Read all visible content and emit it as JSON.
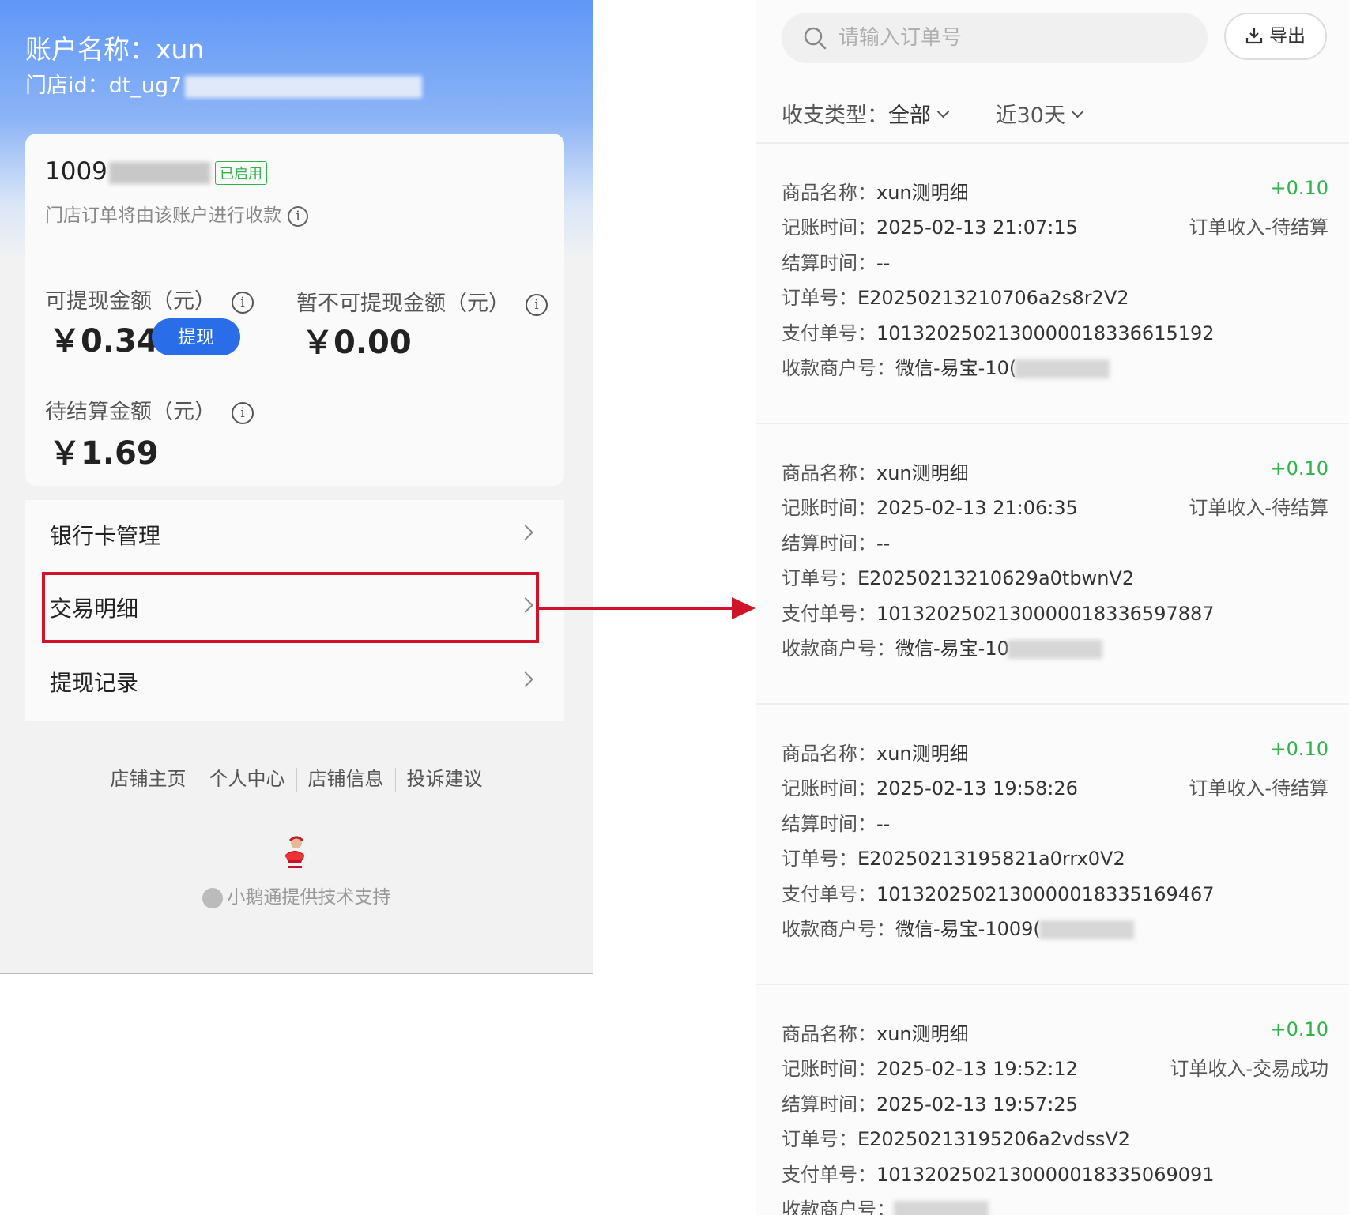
{
  "left": {
    "account_name": "账户名称：xun",
    "store_id": "门店id：dt_ug7",
    "card": {
      "number_prefix": "1009",
      "badge": "已启用",
      "note": "门店订单将由该账户进行收款",
      "withdrawable_label": "可提现金额（元）",
      "withdrawable_value": "￥0.34",
      "withdraw_button": "提现",
      "nonwithdrawable_label": "暂不可提现金额（元）",
      "nonwithdrawable_value": "￥0.00",
      "pending_label": "待结算金额（元）",
      "pending_value": "￥1.69"
    },
    "menu": [
      {
        "label": "银行卡管理"
      },
      {
        "label": "交易明细"
      },
      {
        "label": "提现记录"
      }
    ],
    "footer_links": [
      "店铺主页",
      "个人中心",
      "店铺信息",
      "投诉建议"
    ],
    "support_text": "小鹅通提供技术支持"
  },
  "right": {
    "search_placeholder": "请输入订单号",
    "export_label": "导出",
    "filter_type_label": "收支类型：",
    "filter_type_value": "全部",
    "filter_date_value": "近30天",
    "field_labels": {
      "product": "商品名称：",
      "record_time": "记账时间：",
      "settle_time": "结算时间：",
      "order_no": "订单号：",
      "pay_no": "支付单号：",
      "merchant": "收款商户号："
    },
    "records": [
      {
        "product": "xun测明细",
        "amount": "+0.10",
        "record_time": "2025-02-13 21:07:15",
        "status": "订单收入-待结算",
        "settle_time": "--",
        "order_no": "E20250213210706a2s8r2V2",
        "pay_no": "1013202502130000018336615192",
        "merchant": "微信-易宝-10("
      },
      {
        "product": "xun测明细",
        "amount": "+0.10",
        "record_time": "2025-02-13 21:06:35",
        "status": "订单收入-待结算",
        "settle_time": "--",
        "order_no": "E20250213210629a0tbwnV2",
        "pay_no": "1013202502130000018336597887",
        "merchant": "微信-易宝-10"
      },
      {
        "product": "xun测明细",
        "amount": "+0.10",
        "record_time": "2025-02-13 19:58:26",
        "status": "订单收入-待结算",
        "settle_time": "--",
        "order_no": "E20250213195821a0rrx0V2",
        "pay_no": "1013202502130000018335169467",
        "merchant": "微信-易宝-1009("
      },
      {
        "product": "xun测明细",
        "amount": "+0.10",
        "record_time": "2025-02-13 19:52:12",
        "status": "订单收入-交易成功",
        "settle_time": "2025-02-13 19:57:25",
        "order_no": "E20250213195206a2vdssV2",
        "pay_no": "1013202502130000018335069091",
        "merchant": ""
      }
    ]
  },
  "colors": {
    "accent_blue": "#2a6de8",
    "income_green": "#2fb34a",
    "highlight_red": "#d0132a"
  }
}
